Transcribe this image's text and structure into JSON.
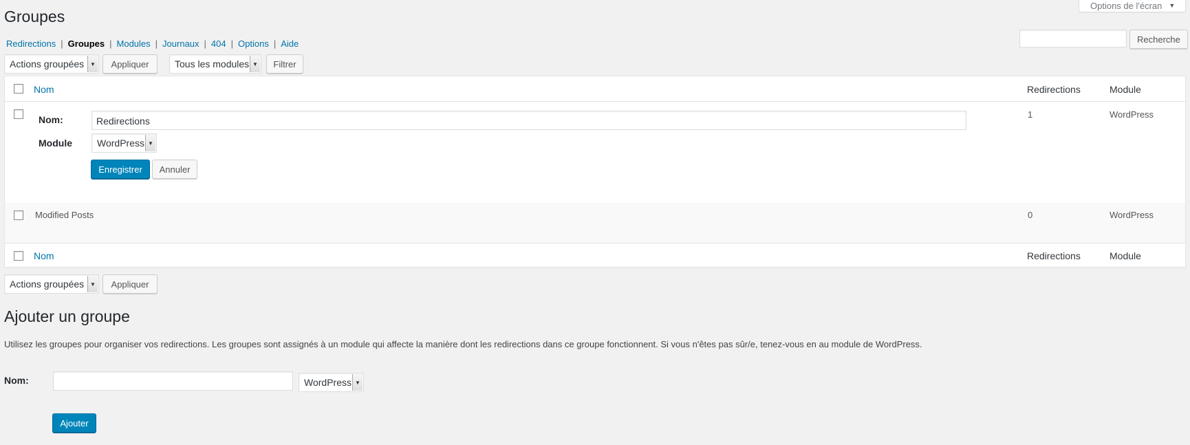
{
  "page": {
    "title": "Groupes"
  },
  "screen_options": {
    "label": "Options de l'écran"
  },
  "subnav": [
    {
      "label": "Redirections",
      "current": false
    },
    {
      "label": "Groupes",
      "current": true
    },
    {
      "label": "Modules",
      "current": false
    },
    {
      "label": "Journaux",
      "current": false
    },
    {
      "label": "404",
      "current": false
    },
    {
      "label": "Options",
      "current": false
    },
    {
      "label": "Aide",
      "current": false
    }
  ],
  "search": {
    "value": "",
    "button_label": "Recherche"
  },
  "top_actions": {
    "bulk_select": "Actions groupées",
    "apply_label": "Appliquer",
    "module_filter": "Tous les modules",
    "filter_label": "Filtrer"
  },
  "table": {
    "headers": {
      "name": "Nom",
      "redirections": "Redirections",
      "module": "Module"
    },
    "edit_row": {
      "name_label": "Nom:",
      "name_value": "Redirections",
      "module_label": "Module",
      "module_value": "WordPress",
      "save_label": "Enregistrer",
      "cancel_label": "Annuler",
      "redirections": "1",
      "module": "WordPress"
    },
    "rows": [
      {
        "name": "Modified Posts",
        "redirections": "0",
        "module": "WordPress"
      }
    ]
  },
  "bottom_actions": {
    "bulk_select": "Actions groupées",
    "apply_label": "Appliquer"
  },
  "add_group": {
    "title": "Ajouter un groupe",
    "description": "Utilisez les groupes pour organiser vos redirections. Les groupes sont assignés à un module qui affecte la manière dont les redirections dans ce groupe fonctionnent. Si vous n'êtes pas sûr/e, tenez-vous en au module de WordPress.",
    "name_label": "Nom:",
    "name_value": "",
    "module_value": "WordPress",
    "submit_label": "Ajouter"
  },
  "colors": {
    "link": "#0073aa",
    "primary_button": "#0085ba",
    "background": "#f1f1f1"
  }
}
